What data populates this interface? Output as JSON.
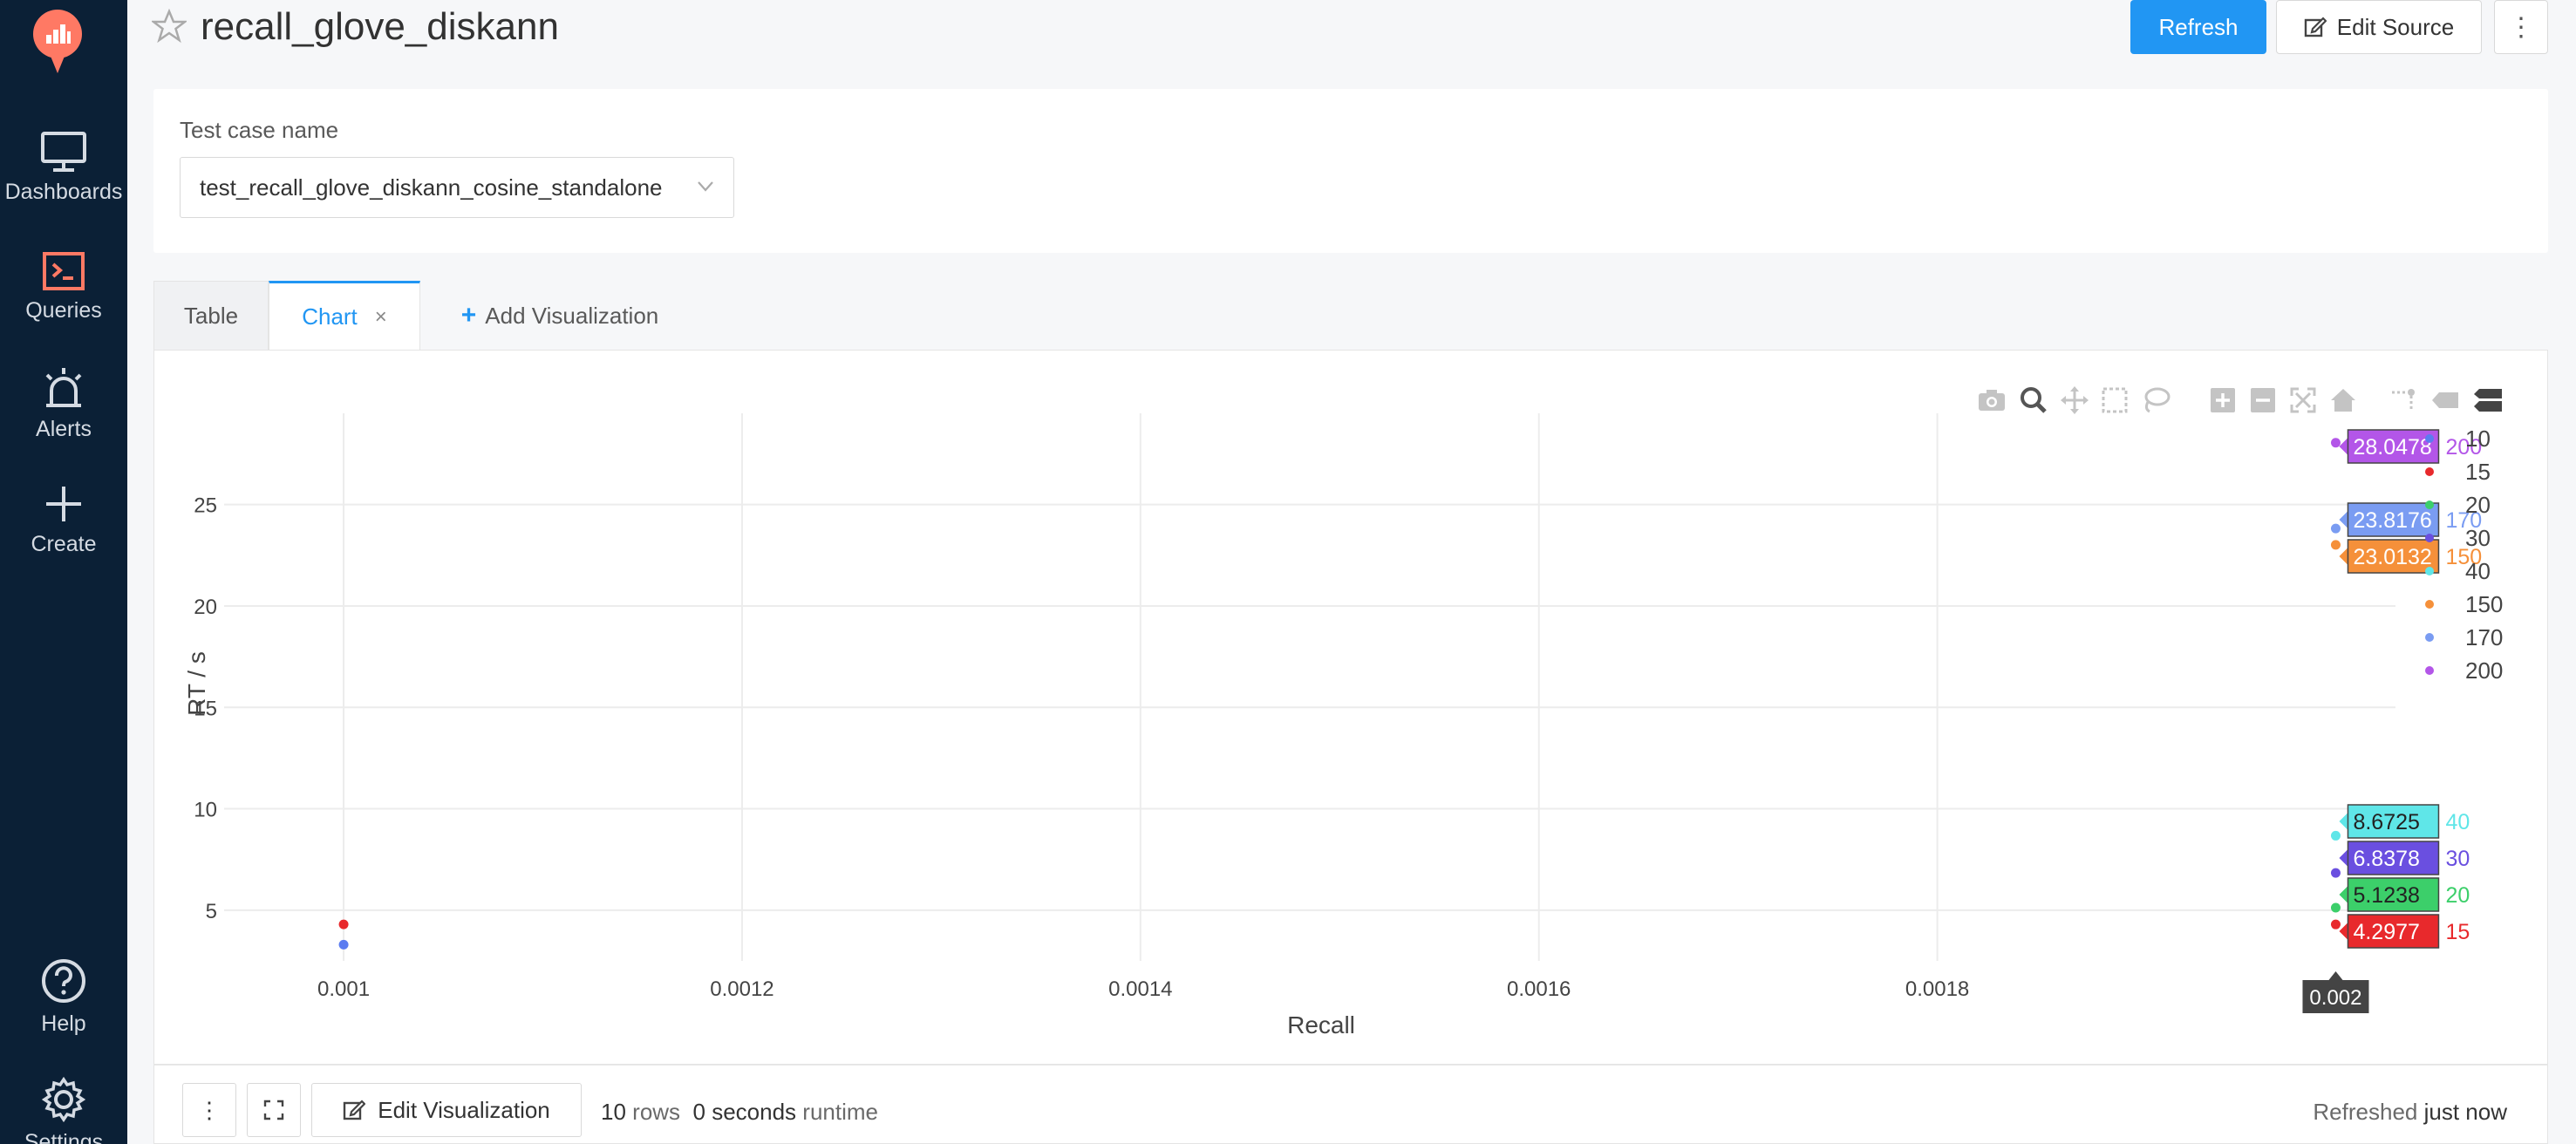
{
  "sidebar": {
    "items": [
      {
        "label": "Dashboards",
        "icon": "monitor-icon"
      },
      {
        "label": "Queries",
        "icon": "terminal-icon"
      },
      {
        "label": "Alerts",
        "icon": "siren-icon"
      },
      {
        "label": "Create",
        "icon": "plus-icon"
      }
    ],
    "bottom": [
      {
        "label": "Help",
        "icon": "question-icon"
      },
      {
        "label": "Settings",
        "icon": "gear-icon"
      }
    ]
  },
  "header": {
    "title": "recall_glove_diskann",
    "refresh_label": "Refresh",
    "edit_source_label": "Edit Source",
    "more_label": "⋮"
  },
  "parameter": {
    "label": "Test case name",
    "value": "test_recall_glove_diskann_cosine_standalone"
  },
  "tabs": {
    "table": "Table",
    "chart": "Chart",
    "close": "×",
    "add": "Add Visualization"
  },
  "footer": {
    "more_label": "⋮",
    "edit_label": "Edit Visualization",
    "rows_count": "10",
    "rows_word": "rows",
    "runtime_value": "0 seconds",
    "runtime_word": "runtime",
    "refreshed_prefix": "Refreshed",
    "refreshed_value": "just now"
  },
  "colors": {
    "accent": "#2196f3",
    "sidebar": "#0b2036",
    "logo": "#ff7964"
  },
  "chart_data": {
    "type": "scatter",
    "xlabel": "Recall",
    "ylabel": "RT / s",
    "xlim": [
      0.00094,
      0.00203
    ],
    "ylim": [
      2.5,
      29.5
    ],
    "x_ticks": [
      "0.001",
      "0.0012",
      "0.0014",
      "0.0016",
      "0.0018"
    ],
    "x_tick_values": [
      0.001,
      0.0012,
      0.0014,
      0.0016,
      0.0018
    ],
    "y_ticks": [
      "5",
      "10",
      "15",
      "20",
      "25"
    ],
    "y_tick_values": [
      5,
      10,
      15,
      20,
      25
    ],
    "grid": true,
    "legend_position": "right",
    "hover_x_label": "0.002",
    "series": [
      {
        "name": "10",
        "color": "#5b7cf0",
        "points": [
          [
            0.001,
            3.3
          ]
        ]
      },
      {
        "name": "15",
        "color": "#e8292c",
        "points": [
          [
            0.001,
            4.3
          ],
          [
            0.002,
            4.2977
          ]
        ]
      },
      {
        "name": "20",
        "color": "#3ccf6a",
        "points": [
          [
            0.002,
            5.1238
          ]
        ]
      },
      {
        "name": "30",
        "color": "#6a4fe0",
        "points": [
          [
            0.002,
            6.8378
          ]
        ]
      },
      {
        "name": "40",
        "color": "#5fe6e8",
        "points": [
          [
            0.002,
            8.6725
          ]
        ]
      },
      {
        "name": "150",
        "color": "#f5903a",
        "points": [
          [
            0.002,
            23.0132
          ]
        ]
      },
      {
        "name": "170",
        "color": "#7a9cf2",
        "points": [
          [
            0.002,
            23.8176
          ]
        ]
      },
      {
        "name": "200",
        "color": "#b356e8",
        "points": [
          [
            0.002,
            28.0478
          ]
        ]
      }
    ],
    "hover_labels": [
      {
        "series": "200",
        "value": "28.0478"
      },
      {
        "series": "170",
        "value": "23.8176"
      },
      {
        "series": "150",
        "value": "23.0132"
      },
      {
        "series": "40",
        "value": "8.6725"
      },
      {
        "series": "30",
        "value": "6.8378"
      },
      {
        "series": "20",
        "value": "5.1238"
      },
      {
        "series": "15",
        "value": "4.2977"
      }
    ]
  }
}
